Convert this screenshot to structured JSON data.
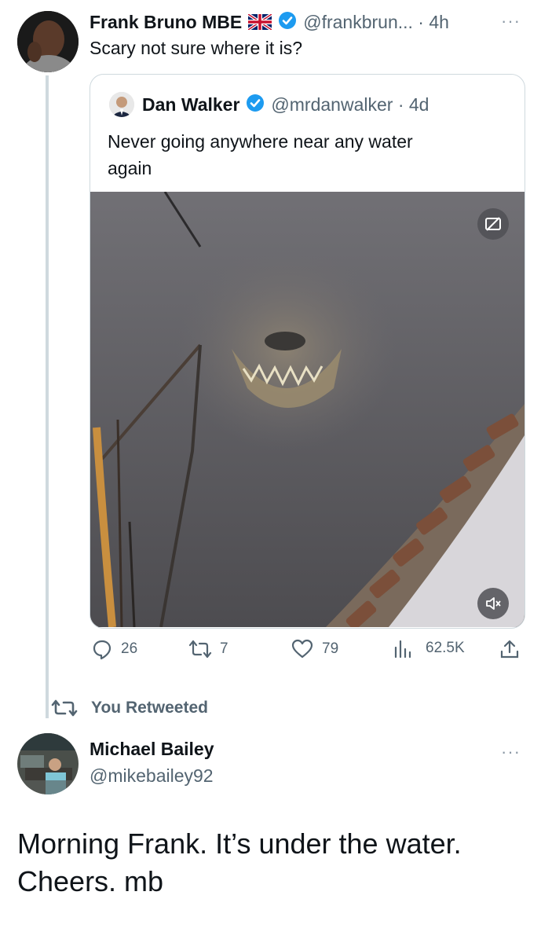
{
  "tweet": {
    "author_name": "Frank Bruno MBE",
    "flag_icon": "uk-flag-icon",
    "handle_time": "@frankbrun... · 4h",
    "text": "Scary not sure where it is?"
  },
  "quote": {
    "author_name": "Dan Walker",
    "handle_time": "@mrdanwalker · 4d",
    "text_line1": "Never going anywhere near any water",
    "text_line2": "again"
  },
  "actions": {
    "replies": "26",
    "retweets": "7",
    "likes": "79",
    "views": "62.5K"
  },
  "retweet_banner": "You Retweeted",
  "reply": {
    "author_name": "Michael Bailey",
    "handle": "@mikebailey92",
    "text_line1": "Morning Frank. It’s under the water.",
    "text_line2": "Cheers. mb"
  },
  "colors": {
    "verified": "#1d9bf0",
    "text": "#0f1419",
    "muted": "#536471"
  }
}
